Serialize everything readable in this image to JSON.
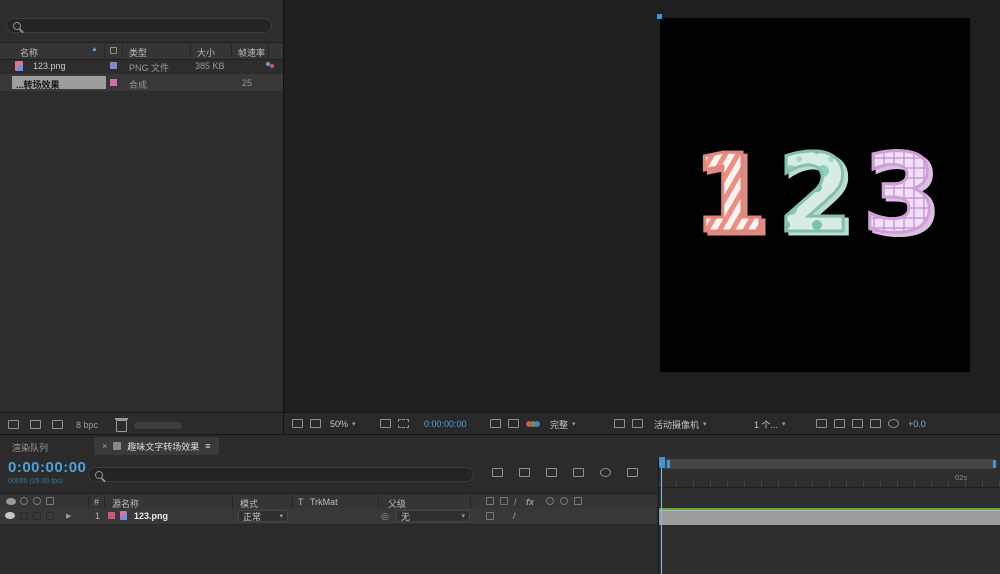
{
  "glyphs": {
    "caret": "▾",
    "sort_asc": "▲",
    "twirl": "▶",
    "close": "×",
    "menu": "≡",
    "pickwhip": "◎",
    "quality_slash": "/",
    "fx": "fx",
    "index_hash": "#"
  },
  "colors": {
    "timecode_blue": "#4aa3dc",
    "playhead_blue": "#3f95cf",
    "work_area_green": "#5fae3c"
  },
  "project": {
    "search_placeholder": "",
    "columns": {
      "name": "名称",
      "type": "类型",
      "size": "大小",
      "fps": "帧速率"
    },
    "rows": [
      {
        "name": "123.png",
        "type": "PNG 文件",
        "size": "385 KB",
        "fps": ""
      },
      {
        "name": "...转场效果",
        "type": "合成",
        "size": "",
        "fps": "25"
      }
    ],
    "footer": {
      "bit_depth": "8 bpc"
    }
  },
  "viewer": {
    "digits": [
      "1",
      "2",
      "3"
    ],
    "toolbar": {
      "zoom": "50%",
      "timecode": "0:00:00:00",
      "resolution": "完整",
      "camera": "活动摄像机",
      "views": "1 个...",
      "exposure": "+0.0"
    }
  },
  "timeline": {
    "tabs": {
      "render_queue": "渲染队列",
      "active": "趣味文字转场效果"
    },
    "timecode": "0:00:00:00",
    "frame_info": "00000 (25.00 fps)",
    "columns": {
      "index": "#",
      "source": "源名称",
      "mode": "模式",
      "t": "T",
      "trkmat": "TrkMat",
      "parent": "父级"
    },
    "layer": {
      "index": "1",
      "name": "123.png",
      "mode": "正常",
      "parent": "无"
    },
    "ruler_label": "02s"
  }
}
